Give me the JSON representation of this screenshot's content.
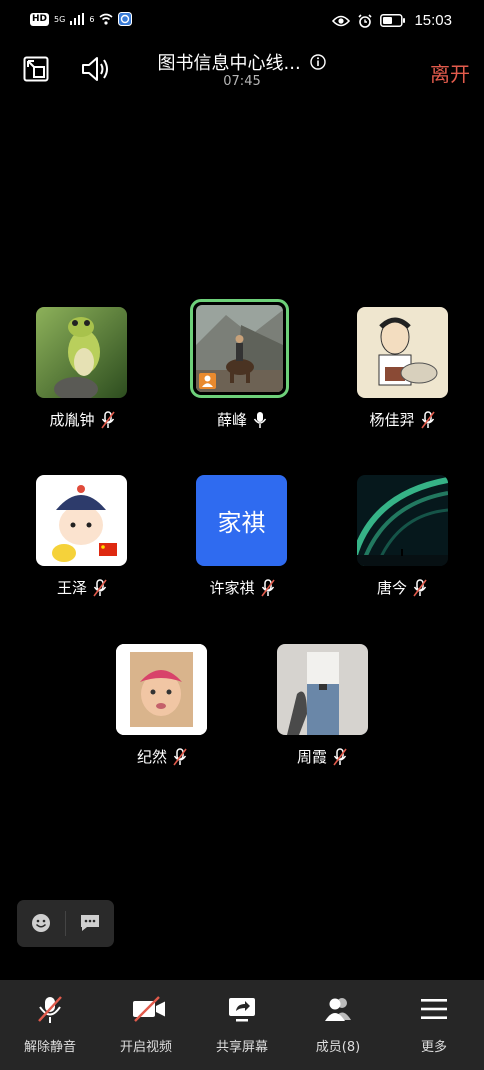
{
  "status_bar": {
    "hd_badge": "HD",
    "network": "5G",
    "wifi_label": "6",
    "time": "15:03"
  },
  "meeting": {
    "title": "图书信息中心线...",
    "elapsed": "07:45",
    "leave_label": "离开"
  },
  "participants": [
    {
      "name": "成胤钟",
      "muted": true,
      "avatar": "frog-photo"
    },
    {
      "name": "薛峰",
      "muted": false,
      "speaking": true,
      "host": true,
      "avatar": "horse-rider-photo"
    },
    {
      "name": "杨佳羿",
      "muted": true,
      "avatar": "caricature-sketch"
    },
    {
      "name": "王泽",
      "muted": true,
      "avatar": "cartoon-boy-with-flag"
    },
    {
      "name": "许家祺",
      "muted": true,
      "avatar_text": "家祺",
      "avatar_color": "#2f6bf0"
    },
    {
      "name": "唐今",
      "muted": true,
      "avatar": "aurora-photo"
    },
    {
      "name": "纪然",
      "muted": true,
      "avatar": "baby-photo"
    },
    {
      "name": "周霞",
      "muted": true,
      "avatar": "fashion-photo"
    }
  ],
  "toolbar": {
    "unmute": "解除静音",
    "start_video": "开启视频",
    "share_screen": "共享屏幕",
    "members": "成员(8)",
    "more": "更多"
  },
  "colors": {
    "leave": "#e25b4c",
    "speaking_border": "#6ed07a",
    "toolbar_bg": "#262626"
  }
}
